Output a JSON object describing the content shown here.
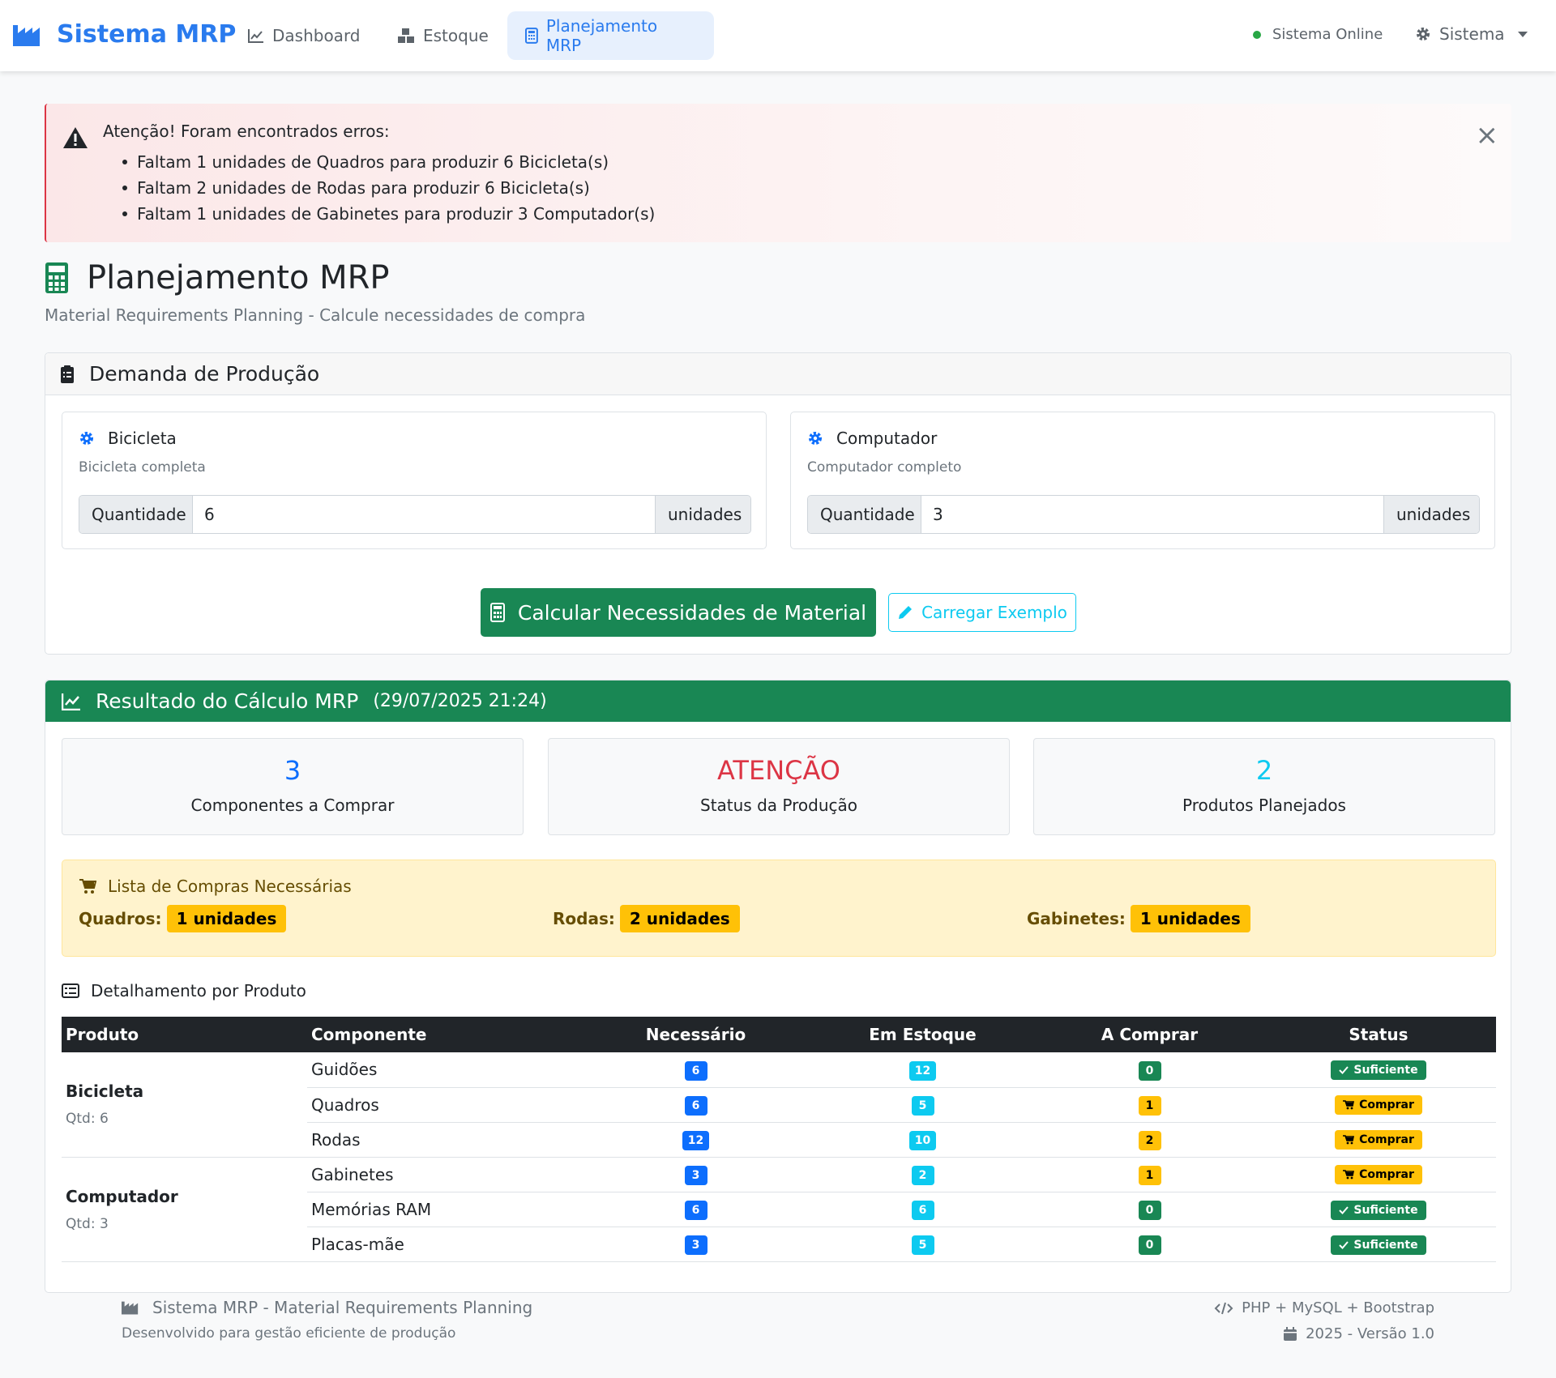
{
  "navbar": {
    "brand": "Sistema MRP",
    "items": [
      {
        "label": "Dashboard",
        "icon": "chart-line-icon",
        "active": false
      },
      {
        "label": "Estoque",
        "icon": "boxes-icon",
        "active": false
      },
      {
        "label": "Planejamento MRP",
        "icon": "calculator-icon",
        "active": true
      }
    ],
    "status": "Sistema Online",
    "system_menu": "Sistema"
  },
  "alert": {
    "title": "Atenção! Foram encontrados erros:",
    "errors": [
      "Faltam 1 unidades de Quadros para produzir 6 Bicicleta(s)",
      "Faltam 2 unidades de Rodas para produzir 6 Bicicleta(s)",
      "Faltam 1 unidades de Gabinetes para produzir 3 Computador(s)"
    ],
    "close": "×"
  },
  "page": {
    "title": "Planejamento MRP",
    "subtitle": "Material Requirements Planning - Calcule necessidades de compra"
  },
  "demand": {
    "header": "Demanda de Produção",
    "products": [
      {
        "name": "Bicicleta",
        "description": "Bicicleta completa",
        "qty_label": "Quantidade",
        "qty_value": "6",
        "unit": "unidades"
      },
      {
        "name": "Computador",
        "description": "Computador completo",
        "qty_label": "Quantidade",
        "qty_value": "3",
        "unit": "unidades"
      }
    ],
    "calc_button": "Calcular Necessidades de Material",
    "example_button": "Carregar Exemplo"
  },
  "result": {
    "header": "Resultado do Cálculo MRP",
    "timestamp": "(29/07/2025 21:24)",
    "stats": [
      {
        "value": "3",
        "label": "Componentes a Comprar",
        "color": "#0d6efd"
      },
      {
        "value": "ATENÇÃO",
        "label": "Status da Produção",
        "color": "#dc3545"
      },
      {
        "value": "2",
        "label": "Produtos Planejados",
        "color": "#0dcaf0"
      }
    ],
    "shopping": {
      "header": "Lista de Compras Necessárias",
      "items": [
        {
          "name": "Quadros:",
          "qty": "1 unidades"
        },
        {
          "name": "Rodas:",
          "qty": "2 unidades"
        },
        {
          "name": "Gabinetes:",
          "qty": "1 unidades"
        }
      ]
    },
    "detail_header": "Detalhamento por Produto",
    "table": {
      "columns": [
        "Produto",
        "Componente",
        "Necessário",
        "Em Estoque",
        "A Comprar",
        "Status"
      ],
      "groups": [
        {
          "product": "Bicicleta",
          "qty": "Qtd: 6",
          "rows": [
            {
              "component": "Guidões",
              "needed": "6",
              "stock": "12",
              "buy": "0",
              "status": "Suficiente"
            },
            {
              "component": "Quadros",
              "needed": "6",
              "stock": "5",
              "buy": "1",
              "status": "Comprar"
            },
            {
              "component": "Rodas",
              "needed": "12",
              "stock": "10",
              "buy": "2",
              "status": "Comprar"
            }
          ]
        },
        {
          "product": "Computador",
          "qty": "Qtd: 3",
          "rows": [
            {
              "component": "Gabinetes",
              "needed": "3",
              "stock": "2",
              "buy": "1",
              "status": "Comprar"
            },
            {
              "component": "Memórias RAM",
              "needed": "6",
              "stock": "6",
              "buy": "0",
              "status": "Suficiente"
            },
            {
              "component": "Placas-mãe",
              "needed": "3",
              "stock": "5",
              "buy": "0",
              "status": "Suficiente"
            }
          ]
        }
      ]
    }
  },
  "footer": {
    "title": "Sistema MRP - Material Requirements Planning",
    "subtitle": "Desenvolvido para gestão eficiente de produção",
    "tech": "PHP + MySQL + Bootstrap",
    "version": "2025 - Versão 1.0"
  }
}
